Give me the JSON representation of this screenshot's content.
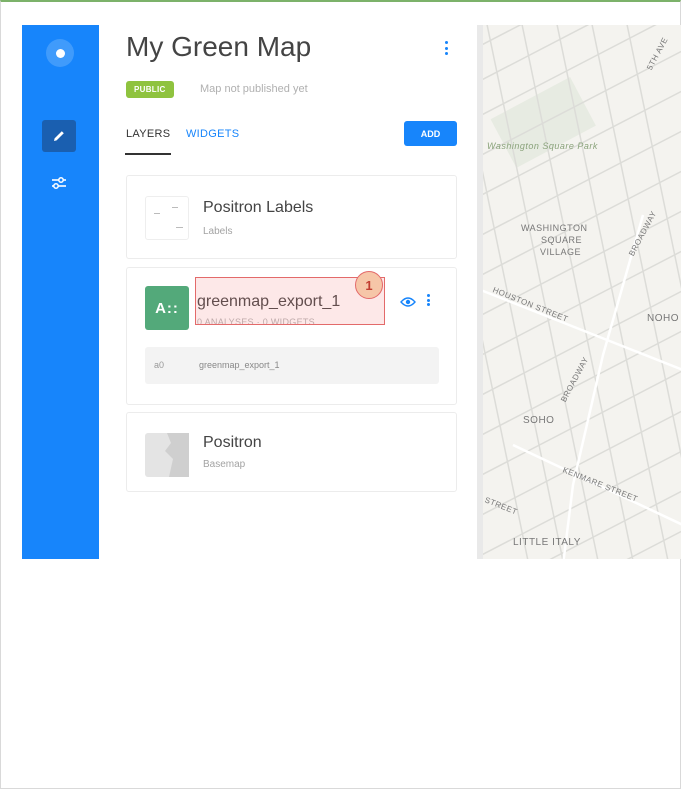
{
  "map_title": "My Green Map",
  "visibility_badge": "PUBLIC",
  "publish_status": "Map not published yet",
  "tabs": {
    "layers": "LAYERS",
    "widgets": "WIDGETS"
  },
  "add_button": "ADD",
  "layers": [
    {
      "name": "Positron Labels",
      "subtitle": "Labels"
    },
    {
      "name": "greenmap_export_1",
      "subtitle": "0 ANALYSES · 0 WIDGETS",
      "thumb_text": "A::",
      "source_id": "a0",
      "source_name": "greenmap_export_1"
    },
    {
      "name": "Positron",
      "subtitle": "Basemap"
    }
  ],
  "step_marker": "1",
  "map_labels": {
    "park": "Washington Square Park",
    "ws_village_1": "WASHINGTON",
    "ws_village_2": "SQUARE",
    "ws_village_3": "VILLAGE",
    "houston": "HOUSTON STREET",
    "broadway_1": "BROADWAY",
    "broadway_2": "BROADWAY",
    "noho": "NOHO",
    "soho": "SOHO",
    "kenmare": "KENMARE STREET",
    "little_italy": "LITTLE ITALY",
    "fifth_ave": "5TH AVE",
    "street": "STREET"
  },
  "colors": {
    "rail": "#1785fb",
    "badge": "#8fc33f",
    "layer_thumb": "#53a97a",
    "highlight": "#e36a6a"
  }
}
